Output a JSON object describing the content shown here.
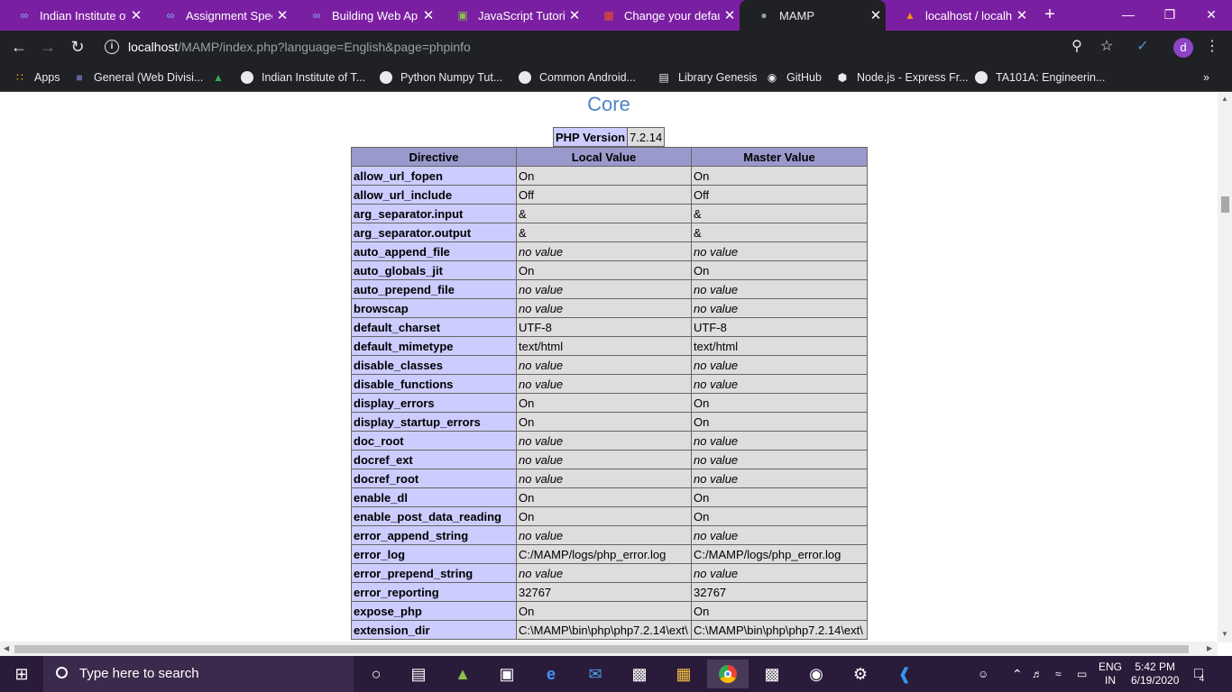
{
  "tabs": [
    {
      "title": "Indian Institute of",
      "favicon": "infinity-icon",
      "color": "#8ab4f8"
    },
    {
      "title": "Assignment Specif",
      "favicon": "infinity-icon",
      "color": "#8ab4f8"
    },
    {
      "title": "Building Web App",
      "favicon": "infinity-icon",
      "color": "#8ab4f8"
    },
    {
      "title": "JavaScript Tutorial",
      "favicon": "chart-icon",
      "color": "#8bc34a"
    },
    {
      "title": "Change your defau",
      "favicon": "windows-icon",
      "color": "#f25022"
    },
    {
      "title": "MAMP",
      "favicon": "globe-icon",
      "color": "#9aa0a6"
    },
    {
      "title": "localhost / localho",
      "favicon": "phpmyadmin-icon",
      "color": "#f29111"
    }
  ],
  "url": {
    "host": "localhost",
    "path": "/MAMP/index.php?language=English&page=phpinfo"
  },
  "bookmarks": [
    {
      "label": "Apps",
      "icon": "apps-grid-icon"
    },
    {
      "label": "General (Web Divisi...",
      "icon": "teams-icon"
    },
    {
      "label": "",
      "icon": "drive-icon"
    },
    {
      "label": "Indian Institute of T...",
      "icon": "globe-icon"
    },
    {
      "label": "Python Numpy Tut...",
      "icon": "globe-icon"
    },
    {
      "label": "Common Android...",
      "icon": "globe-icon"
    },
    {
      "label": "Library Genesis",
      "icon": "book-icon"
    },
    {
      "label": "GitHub",
      "icon": "github-icon"
    },
    {
      "label": "Node.js - Express Fr...",
      "icon": "node-icon"
    },
    {
      "label": "TA101A: Engineerin...",
      "icon": "globe-icon"
    }
  ],
  "page": {
    "section_title": "Core",
    "php_version_label": "PHP Version",
    "php_version": "7.2.14",
    "headers": [
      "Directive",
      "Local Value",
      "Master Value"
    ],
    "rows": [
      [
        "allow_url_fopen",
        "On",
        "On"
      ],
      [
        "allow_url_include",
        "Off",
        "Off"
      ],
      [
        "arg_separator.input",
        "&",
        "&"
      ],
      [
        "arg_separator.output",
        "&",
        "&"
      ],
      [
        "auto_append_file",
        "no value",
        "no value"
      ],
      [
        "auto_globals_jit",
        "On",
        "On"
      ],
      [
        "auto_prepend_file",
        "no value",
        "no value"
      ],
      [
        "browscap",
        "no value",
        "no value"
      ],
      [
        "default_charset",
        "UTF-8",
        "UTF-8"
      ],
      [
        "default_mimetype",
        "text/html",
        "text/html"
      ],
      [
        "disable_classes",
        "no value",
        "no value"
      ],
      [
        "disable_functions",
        "no value",
        "no value"
      ],
      [
        "display_errors",
        "On",
        "On"
      ],
      [
        "display_startup_errors",
        "On",
        "On"
      ],
      [
        "doc_root",
        "no value",
        "no value"
      ],
      [
        "docref_ext",
        "no value",
        "no value"
      ],
      [
        "docref_root",
        "no value",
        "no value"
      ],
      [
        "enable_dl",
        "On",
        "On"
      ],
      [
        "enable_post_data_reading",
        "On",
        "On"
      ],
      [
        "error_append_string",
        "no value",
        "no value"
      ],
      [
        "error_log",
        "C:/MAMP/logs/php_error.log",
        "C:/MAMP/logs/php_error.log"
      ],
      [
        "error_prepend_string",
        "no value",
        "no value"
      ],
      [
        "error_reporting",
        "32767",
        "32767"
      ],
      [
        "expose_php",
        "On",
        "On"
      ],
      [
        "extension_dir",
        "C:\\MAMP\\bin\\php\\php7.2.14\\ext\\",
        "C:\\MAMP\\bin\\php\\php7.2.14\\ext\\"
      ]
    ]
  },
  "taskbar": {
    "search_placeholder": "Type here to search",
    "language": "ENG",
    "region": "IN",
    "time": "5:42 PM",
    "date": "6/19/2020",
    "notifications": "4"
  }
}
